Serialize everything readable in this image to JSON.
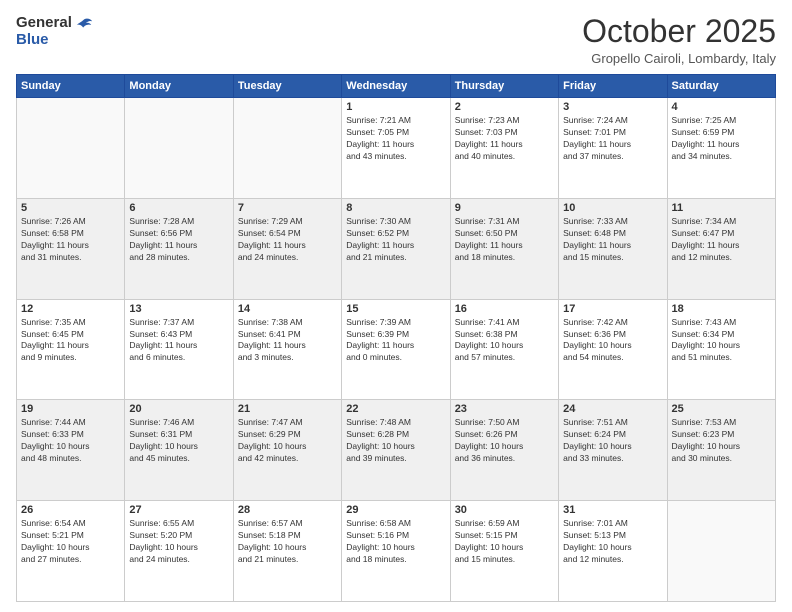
{
  "logo": {
    "general": "General",
    "blue": "Blue"
  },
  "title": "October 2025",
  "location": "Gropello Cairoli, Lombardy, Italy",
  "days_of_week": [
    "Sunday",
    "Monday",
    "Tuesday",
    "Wednesday",
    "Thursday",
    "Friday",
    "Saturday"
  ],
  "weeks": [
    [
      {
        "day": "",
        "info": ""
      },
      {
        "day": "",
        "info": ""
      },
      {
        "day": "",
        "info": ""
      },
      {
        "day": "1",
        "info": "Sunrise: 7:21 AM\nSunset: 7:05 PM\nDaylight: 11 hours\nand 43 minutes."
      },
      {
        "day": "2",
        "info": "Sunrise: 7:23 AM\nSunset: 7:03 PM\nDaylight: 11 hours\nand 40 minutes."
      },
      {
        "day": "3",
        "info": "Sunrise: 7:24 AM\nSunset: 7:01 PM\nDaylight: 11 hours\nand 37 minutes."
      },
      {
        "day": "4",
        "info": "Sunrise: 7:25 AM\nSunset: 6:59 PM\nDaylight: 11 hours\nand 34 minutes."
      }
    ],
    [
      {
        "day": "5",
        "info": "Sunrise: 7:26 AM\nSunset: 6:58 PM\nDaylight: 11 hours\nand 31 minutes."
      },
      {
        "day": "6",
        "info": "Sunrise: 7:28 AM\nSunset: 6:56 PM\nDaylight: 11 hours\nand 28 minutes."
      },
      {
        "day": "7",
        "info": "Sunrise: 7:29 AM\nSunset: 6:54 PM\nDaylight: 11 hours\nand 24 minutes."
      },
      {
        "day": "8",
        "info": "Sunrise: 7:30 AM\nSunset: 6:52 PM\nDaylight: 11 hours\nand 21 minutes."
      },
      {
        "day": "9",
        "info": "Sunrise: 7:31 AM\nSunset: 6:50 PM\nDaylight: 11 hours\nand 18 minutes."
      },
      {
        "day": "10",
        "info": "Sunrise: 7:33 AM\nSunset: 6:48 PM\nDaylight: 11 hours\nand 15 minutes."
      },
      {
        "day": "11",
        "info": "Sunrise: 7:34 AM\nSunset: 6:47 PM\nDaylight: 11 hours\nand 12 minutes."
      }
    ],
    [
      {
        "day": "12",
        "info": "Sunrise: 7:35 AM\nSunset: 6:45 PM\nDaylight: 11 hours\nand 9 minutes."
      },
      {
        "day": "13",
        "info": "Sunrise: 7:37 AM\nSunset: 6:43 PM\nDaylight: 11 hours\nand 6 minutes."
      },
      {
        "day": "14",
        "info": "Sunrise: 7:38 AM\nSunset: 6:41 PM\nDaylight: 11 hours\nand 3 minutes."
      },
      {
        "day": "15",
        "info": "Sunrise: 7:39 AM\nSunset: 6:39 PM\nDaylight: 11 hours\nand 0 minutes."
      },
      {
        "day": "16",
        "info": "Sunrise: 7:41 AM\nSunset: 6:38 PM\nDaylight: 10 hours\nand 57 minutes."
      },
      {
        "day": "17",
        "info": "Sunrise: 7:42 AM\nSunset: 6:36 PM\nDaylight: 10 hours\nand 54 minutes."
      },
      {
        "day": "18",
        "info": "Sunrise: 7:43 AM\nSunset: 6:34 PM\nDaylight: 10 hours\nand 51 minutes."
      }
    ],
    [
      {
        "day": "19",
        "info": "Sunrise: 7:44 AM\nSunset: 6:33 PM\nDaylight: 10 hours\nand 48 minutes."
      },
      {
        "day": "20",
        "info": "Sunrise: 7:46 AM\nSunset: 6:31 PM\nDaylight: 10 hours\nand 45 minutes."
      },
      {
        "day": "21",
        "info": "Sunrise: 7:47 AM\nSunset: 6:29 PM\nDaylight: 10 hours\nand 42 minutes."
      },
      {
        "day": "22",
        "info": "Sunrise: 7:48 AM\nSunset: 6:28 PM\nDaylight: 10 hours\nand 39 minutes."
      },
      {
        "day": "23",
        "info": "Sunrise: 7:50 AM\nSunset: 6:26 PM\nDaylight: 10 hours\nand 36 minutes."
      },
      {
        "day": "24",
        "info": "Sunrise: 7:51 AM\nSunset: 6:24 PM\nDaylight: 10 hours\nand 33 minutes."
      },
      {
        "day": "25",
        "info": "Sunrise: 7:53 AM\nSunset: 6:23 PM\nDaylight: 10 hours\nand 30 minutes."
      }
    ],
    [
      {
        "day": "26",
        "info": "Sunrise: 6:54 AM\nSunset: 5:21 PM\nDaylight: 10 hours\nand 27 minutes."
      },
      {
        "day": "27",
        "info": "Sunrise: 6:55 AM\nSunset: 5:20 PM\nDaylight: 10 hours\nand 24 minutes."
      },
      {
        "day": "28",
        "info": "Sunrise: 6:57 AM\nSunset: 5:18 PM\nDaylight: 10 hours\nand 21 minutes."
      },
      {
        "day": "29",
        "info": "Sunrise: 6:58 AM\nSunset: 5:16 PM\nDaylight: 10 hours\nand 18 minutes."
      },
      {
        "day": "30",
        "info": "Sunrise: 6:59 AM\nSunset: 5:15 PM\nDaylight: 10 hours\nand 15 minutes."
      },
      {
        "day": "31",
        "info": "Sunrise: 7:01 AM\nSunset: 5:13 PM\nDaylight: 10 hours\nand 12 minutes."
      },
      {
        "day": "",
        "info": ""
      }
    ]
  ]
}
